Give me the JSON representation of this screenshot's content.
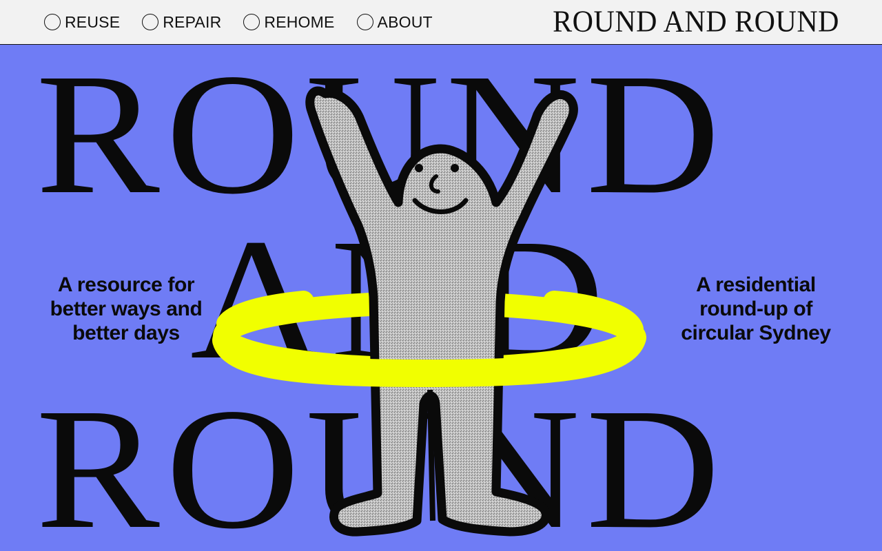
{
  "nav": {
    "items": [
      {
        "label": "REUSE"
      },
      {
        "label": "REPAIR"
      },
      {
        "label": "REHOME"
      },
      {
        "label": "ABOUT"
      }
    ]
  },
  "brand": "ROUND AND ROUND",
  "hero": {
    "word_top": "ROUND",
    "word_middle": "AND",
    "word_bottom": "ROUND",
    "left_tagline": "A resource for better ways and better days",
    "right_tagline": "A residential round-up of circular Sydney"
  },
  "colors": {
    "background": "#6f7cf5",
    "topbar": "#f2f2f2",
    "hoop": "#f1ff00",
    "figure": "#b9b9b9",
    "ink": "#0a0a0a"
  },
  "illustration": {
    "icon": "hula-hoop-person-illustration"
  }
}
